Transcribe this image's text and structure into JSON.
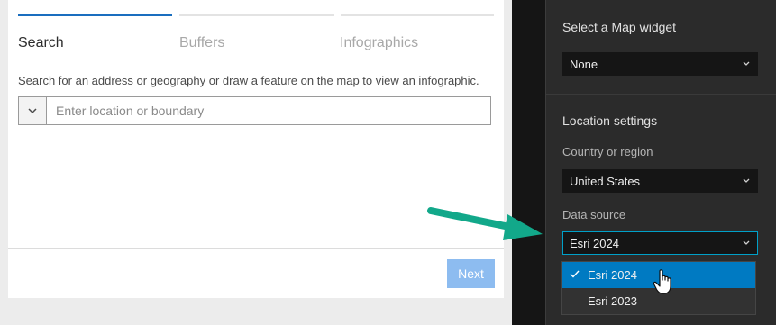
{
  "wizard": {
    "steps": [
      {
        "label": "Search",
        "state": "active"
      },
      {
        "label": "Buffers",
        "state": "inactive"
      },
      {
        "label": "Infographics",
        "state": "inactive"
      }
    ],
    "description": "Search for an address or geography or draw a feature on the map to view an infographic.",
    "search_placeholder": "Enter location or boundary",
    "next_label": "Next"
  },
  "settings": {
    "map_widget": {
      "title": "Select a Map widget",
      "value": "None"
    },
    "location": {
      "title": "Location settings",
      "country_label": "Country or region",
      "country_value": "United States",
      "datasource_label": "Data source",
      "datasource_value": "Esri 2024",
      "datasource_options": [
        {
          "label": "Esri 2024",
          "selected": true
        },
        {
          "label": "Esri 2023",
          "selected": false
        }
      ]
    }
  },
  "colors": {
    "active_step": "#1a6ebf",
    "accent_focus": "#00a0c8",
    "selected_option": "#007ac2",
    "annotation_arrow": "#12a88a",
    "next_button": "#8dbcf0"
  },
  "icons": {
    "search_dropdown": "chevron-down-icon",
    "select_chevron": "chevron-down-icon",
    "selected_option": "check-icon",
    "cursor": "hand-pointer-icon",
    "annotation": "arrow-right-icon"
  }
}
